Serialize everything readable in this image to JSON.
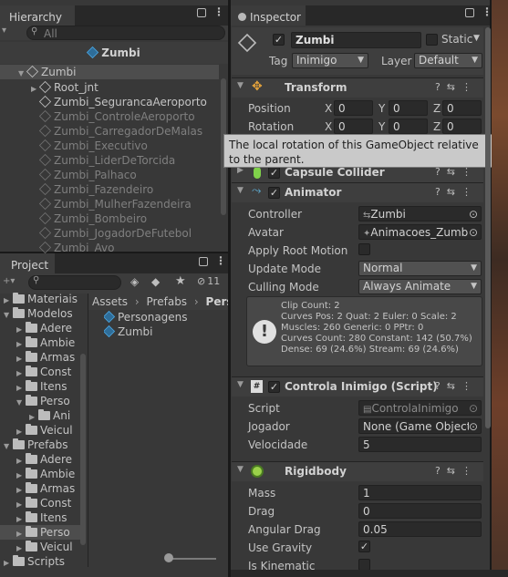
{
  "hierarchy": {
    "tab_label": "Hierarchy",
    "search_placeholder": "All",
    "scene_title": "Zumbi",
    "root_item": "Zumbi",
    "items": [
      {
        "label": "Root_jnt",
        "dim": false
      },
      {
        "label": "Zumbi_SegurancaAeroporto",
        "dim": false
      },
      {
        "label": "Zumbi_ControleAeroporto",
        "dim": true
      },
      {
        "label": "Zumbi_CarregadorDeMalas",
        "dim": true
      },
      {
        "label": "Zumbi_Executivo",
        "dim": true
      },
      {
        "label": "Zumbi_LiderDeTorcida",
        "dim": true
      },
      {
        "label": "Zumbi_Palhaco",
        "dim": true
      },
      {
        "label": "Zumbi_Fazendeiro",
        "dim": true
      },
      {
        "label": "Zumbi_MulherFazendeira",
        "dim": true
      },
      {
        "label": "Zumbi_Bombeiro",
        "dim": true
      },
      {
        "label": "Zumbi_JogadorDeFutebol",
        "dim": true
      },
      {
        "label": "Zumbi_Avo",
        "dim": true
      }
    ]
  },
  "project": {
    "tab_label": "Project",
    "hidden_count": "11",
    "tree": [
      {
        "label": "Materiais",
        "indent": 0
      },
      {
        "label": "Modelos",
        "indent": 0
      },
      {
        "label": "Adere",
        "indent": 1
      },
      {
        "label": "Ambie",
        "indent": 1
      },
      {
        "label": "Armas",
        "indent": 1
      },
      {
        "label": "Const",
        "indent": 1
      },
      {
        "label": "Itens",
        "indent": 1
      },
      {
        "label": "Perso",
        "indent": 1
      },
      {
        "label": "Ani",
        "indent": 2
      },
      {
        "label": "Veicul",
        "indent": 1
      },
      {
        "label": "Prefabs",
        "indent": 0
      },
      {
        "label": "Adere",
        "indent": 1
      },
      {
        "label": "Ambie",
        "indent": 1
      },
      {
        "label": "Armas",
        "indent": 1
      },
      {
        "label": "Const",
        "indent": 1
      },
      {
        "label": "Itens",
        "indent": 1
      },
      {
        "label": "Perso",
        "indent": 1
      },
      {
        "label": "Veicul",
        "indent": 1
      },
      {
        "label": "Scripts",
        "indent": 0
      }
    ],
    "breadcrumb": [
      "Assets",
      "Prefabs",
      "Perso"
    ],
    "files": [
      "Personagens",
      "Zumbi"
    ]
  },
  "inspector": {
    "tab_label": "Inspector",
    "object_name": "Zumbi",
    "static_label": "Static",
    "tag_label": "Tag",
    "tag_value": "Inimigo",
    "layer_label": "Layer",
    "layer_value": "Default",
    "transform": {
      "title": "Transform",
      "position_label": "Position",
      "rotation_label": "Rotation",
      "x": "X",
      "y": "Y",
      "z": "Z",
      "pos": [
        "0",
        "0",
        "0"
      ],
      "rot": [
        "0",
        "0",
        "0"
      ],
      "tooltip": "The local rotation of this GameObject relative to the parent."
    },
    "capsule": {
      "title": "Capsule Collider"
    },
    "animator": {
      "title": "Animator",
      "controller_label": "Controller",
      "controller_value": "Zumbi",
      "avatar_label": "Avatar",
      "avatar_value": "Animacoes_Zumbi",
      "apply_root_label": "Apply Root Motion",
      "update_mode_label": "Update Mode",
      "update_mode_value": "Normal",
      "culling_label": "Culling Mode",
      "culling_value": "Always Animate",
      "info": [
        "Clip Count: 2",
        "Curves Pos: 2 Quat: 2 Euler: 0 Scale: 2",
        "Muscles: 260 Generic: 0 PPtr: 0",
        "Curves Count: 280 Constant: 142 (50.7%)",
        "Dense: 69 (24.6%) Stream: 69 (24.6%)"
      ]
    },
    "script": {
      "title": "Controla Inimigo (Script)",
      "script_label": "Script",
      "script_value": "ControlaInimigo",
      "jogador_label": "Jogador",
      "jogador_value": "None (Game Object)",
      "velocidade_label": "Velocidade",
      "velocidade_value": "5"
    },
    "rigidbody": {
      "title": "Rigidbody",
      "mass_label": "Mass",
      "mass_value": "1",
      "drag_label": "Drag",
      "drag_value": "0",
      "angular_label": "Angular Drag",
      "angular_value": "0.05",
      "gravity_label": "Use Gravity",
      "kinematic_label": "Is Kinematic"
    }
  },
  "colors": {
    "panel_bg": "#383838",
    "header_bg": "#3e3e3e",
    "field_bg": "#2a2a2a",
    "dropdown_bg": "#515151",
    "accent_blue": "#4aa0d8",
    "selection": "#4d4d4d"
  }
}
